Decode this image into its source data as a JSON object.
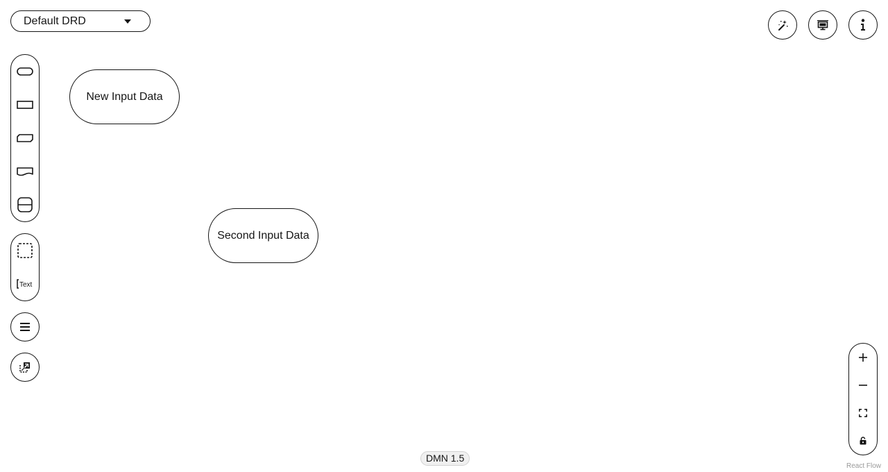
{
  "drd_selector": {
    "label": "Default DRD"
  },
  "toolbar_right": {
    "buttons": [
      {
        "name": "auto-layout",
        "icon": "magic-wand-icon"
      },
      {
        "name": "overlays",
        "icon": "screen-icon"
      },
      {
        "name": "properties",
        "icon": "info-icon"
      }
    ]
  },
  "palette": {
    "nodes": [
      {
        "name": "input-data",
        "icon": "rounded-pill-icon"
      },
      {
        "name": "decision",
        "icon": "rectangle-icon"
      },
      {
        "name": "business-knowledge-model",
        "icon": "clipped-rectangle-icon"
      },
      {
        "name": "knowledge-source",
        "icon": "wavy-rectangle-icon"
      },
      {
        "name": "decision-service",
        "icon": "split-rounded-rectangle-icon"
      }
    ],
    "artifacts": [
      {
        "name": "group",
        "icon": "dashed-square-icon"
      },
      {
        "name": "text-annotation",
        "icon": "text-annotation-icon",
        "label": "Text"
      }
    ]
  },
  "nodes": [
    {
      "label": "New Input Data",
      "type": "input-data"
    },
    {
      "label": "Second Input Data",
      "type": "input-data"
    }
  ],
  "zoom_controls": [
    {
      "name": "zoom-in",
      "icon": "plus-icon"
    },
    {
      "name": "zoom-out",
      "icon": "minus-icon"
    },
    {
      "name": "fit-view",
      "icon": "expand-icon"
    },
    {
      "name": "lock",
      "icon": "lock-icon"
    }
  ],
  "footer": {
    "version": "DMN 1.5",
    "attribution": "React Flow"
  }
}
